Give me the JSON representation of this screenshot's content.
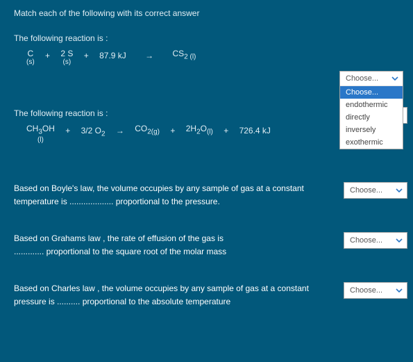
{
  "instructions": "Match each of the following with its correct answer",
  "q1": {
    "prompt": "The following reaction is :",
    "eq": {
      "c": "C",
      "c_s": "(s)",
      "plus1": "+",
      "two_s": "2 S",
      "two_s_s": "(s)",
      "plus2": "+",
      "energy": "87.9 kJ",
      "arrow": "→",
      "cs": "CS",
      "cs_sub": "2 (l)"
    }
  },
  "q2": {
    "prompt": "The following reaction is :",
    "eq": {
      "ch3oh": "CH",
      "sub1": "3",
      "oh": "OH",
      "l": "(l)",
      "plus1": "+",
      "frac": "3/2 O",
      "o2sub": "2",
      "arr": "→",
      "co": "CO",
      "co_sub": "2(g)",
      "plus2": "+",
      "h2o": "2H",
      "h2osub1": "2",
      "h2o_o": "O",
      "h2o_sub2": "(l)",
      "plus3": "+",
      "energy": "726.4 kJ"
    }
  },
  "q3": {
    "line1": "Based on Boyle's law, the volume occupies by any sample of gas at a constant",
    "line2": "temperature is ................... proportional to the pressure."
  },
  "q4": {
    "line1": "Based on Grahams law , the rate of effusion of the gas is",
    "line2": "............. proportional to the square root of the molar mass"
  },
  "q5": {
    "line1": "Based on Charles law , the volume occupies by any sample of gas at a constant",
    "line2": "pressure is .......... proportional to the absolute temperature"
  },
  "select": {
    "placeholder": "Choose..."
  },
  "dropdown": {
    "opt0": "Choose...",
    "opt1": "endothermic",
    "opt2": "directly",
    "opt3": "inversely",
    "opt4": "exothermic"
  }
}
